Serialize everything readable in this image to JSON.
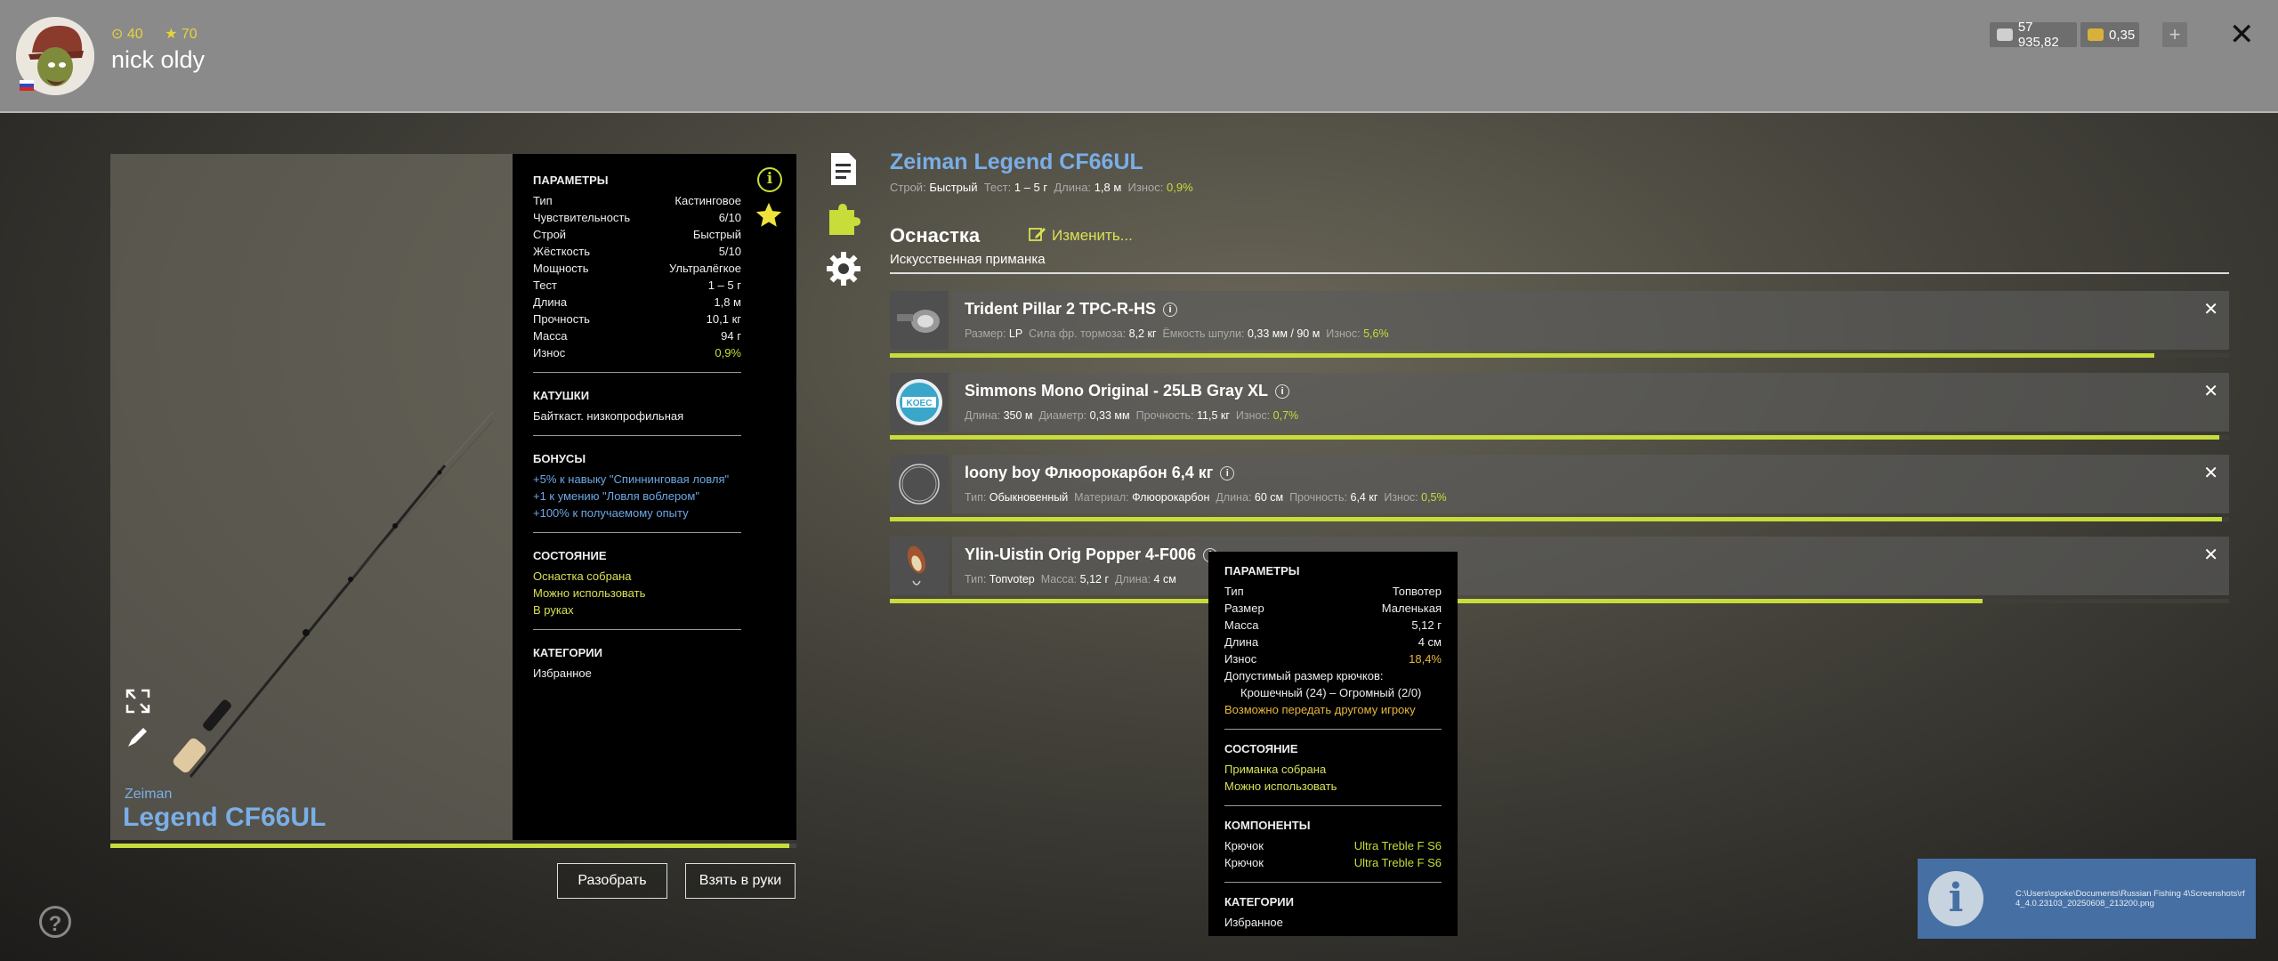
{
  "header": {
    "stat_level": "40",
    "stat_rank": "70",
    "player_name": "nick oldy",
    "silver": "57 935,82",
    "gold": "0,35",
    "plus": "+",
    "close": "✕"
  },
  "rod": {
    "brand": "Zeiman",
    "model": "Legend CF66UL",
    "title": "Zeiman Legend CF66UL",
    "specs": [
      {
        "label": "Строй:",
        "value": "Быстрый"
      },
      {
        "label": "Тест:",
        "value": "1 – 5 г"
      },
      {
        "label": "Длина:",
        "value": "1,8 м"
      },
      {
        "label": "Износ:",
        "value": "0,9%"
      }
    ],
    "wear_fraction": 0.99
  },
  "params": {
    "title": "ПАРАМЕТРЫ",
    "rows": [
      {
        "k": "Тип",
        "v": "Кастинговое"
      },
      {
        "k": "Чувствительность",
        "v": "6/10"
      },
      {
        "k": "Строй",
        "v": "Быстрый"
      },
      {
        "k": "Жёсткость",
        "v": "5/10"
      },
      {
        "k": "Мощность",
        "v": "Ультралёгкое"
      },
      {
        "k": "Тест",
        "v": "1 – 5 г"
      },
      {
        "k": "Длина",
        "v": "1,8 м"
      },
      {
        "k": "Прочность",
        "v": "10,1 кг"
      },
      {
        "k": "Масса",
        "v": "94 г"
      },
      {
        "k": "Износ",
        "v": "0,9%"
      }
    ],
    "reels_title": "КАТУШКИ",
    "reels_value": "Байткаст. низкопрофильная",
    "bonus_title": "БОНУСЫ",
    "bonuses": [
      "+5% к навыку \"Спиннинговая ловля\"",
      "+1 к умению \"Ловля воблером\"",
      "+100% к получаемому опыту"
    ],
    "state_title": "СОСТОЯНИЕ",
    "states": [
      "Оснастка собрана",
      "Можно использовать",
      "В руках"
    ],
    "cat_title": "КАТЕГОРИИ",
    "category": "Избранное"
  },
  "buttons": {
    "disassemble": "Разобрать",
    "take": "Взять в руки",
    "help": "?"
  },
  "tackle": {
    "title": "Оснастка",
    "change": "Изменить...",
    "subtitle": "Искусственная приманка",
    "items": [
      {
        "name": "Trident Pillar 2 TPC-R-HS",
        "specs": [
          {
            "label": "Размер:",
            "value": "LP"
          },
          {
            "label": "Сила фр. тормоза:",
            "value": "8,2 кг"
          },
          {
            "label": "Ёмкость шпули:",
            "value": "0,33 мм / 90 м"
          },
          {
            "label": "Износ:",
            "value": "5,6%"
          }
        ],
        "condition": 0.944
      },
      {
        "name": "Simmons Mono Original - 25LB Gray XL",
        "specs": [
          {
            "label": "Длина:",
            "value": "350 м"
          },
          {
            "label": "Диаметр:",
            "value": "0,33 мм"
          },
          {
            "label": "Прочность:",
            "value": "11,5 кг"
          },
          {
            "label": "Износ:",
            "value": "0,7%"
          }
        ],
        "condition": 0.993
      },
      {
        "name": "loony boy Флюорокарбон 6,4 кг",
        "specs": [
          {
            "label": "Тип:",
            "value": "Обыкновенный"
          },
          {
            "label": "Материал:",
            "value": "Флюорокарбон"
          },
          {
            "label": "Длина:",
            "value": "60 см"
          },
          {
            "label": "Прочность:",
            "value": "6,4 кг"
          },
          {
            "label": "Износ:",
            "value": "0,5%"
          }
        ],
        "condition": 0.995
      },
      {
        "name": "Ylin-Uistin Orig Popper 4-F006",
        "specs": [
          {
            "label": "Тип:",
            "value": "Топvotер"
          },
          {
            "label": "Масса:",
            "value": "5,12 г"
          },
          {
            "label": "Длина:",
            "value": "4 см"
          }
        ],
        "condition": 0.816
      }
    ]
  },
  "tooltip": {
    "title": "ПАРАМЕТРЫ",
    "rows": [
      {
        "k": "Тип",
        "v": "Топвотер"
      },
      {
        "k": "Размер",
        "v": "Маленькая"
      },
      {
        "k": "Масса",
        "v": "5,12 г"
      },
      {
        "k": "Длина",
        "v": "4 см"
      },
      {
        "k": "Износ",
        "v": "18,4%"
      }
    ],
    "hook_label": "Допустимый размер крючков:",
    "hook_value": "Крошечный (24) – Огромный (2/0)",
    "transfer": "Возможно передать другому игроку",
    "state_title": "СОСТОЯНИЕ",
    "states": [
      "Приманка собрана",
      "Можно использовать"
    ],
    "comp_title": "КОМПОНЕНТЫ",
    "components": [
      {
        "k": "Крючок",
        "v": "Ultra Treble F S6"
      },
      {
        "k": "Крючок",
        "v": "Ultra Treble F S6"
      }
    ],
    "cat_title": "КАТЕГОРИИ",
    "category": "Избранное"
  },
  "notification": {
    "icon": "i",
    "text": "C:\\Users\\spoke\\Documents\\Russian Fishing 4\\Screenshots\\rf4_4.0.23103_20250608_213200.png"
  },
  "colors": {
    "accent_blue": "#7aaee6",
    "accent_yellow": "#c8dc3a",
    "header_bg": "#8a8a8a"
  }
}
